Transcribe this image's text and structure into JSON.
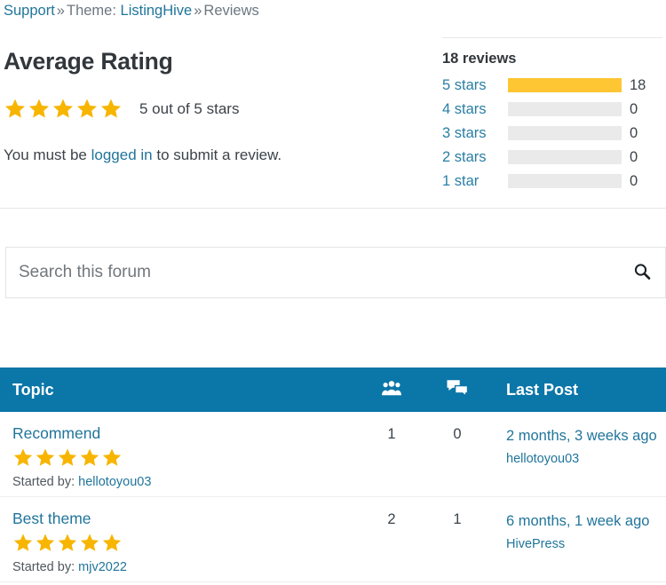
{
  "breadcrumb": {
    "support": "Support",
    "sep1": "»",
    "theme": "Theme: ListingHive",
    "sep2": "»",
    "current": "Reviews"
  },
  "rating": {
    "heading": "Average Rating",
    "stars_filled": 5,
    "summary": "5 out of 5 stars",
    "login_prefix": "You must be ",
    "login_link": "logged in",
    "login_suffix": " to submit a review."
  },
  "breakdown": {
    "title": "18 reviews",
    "total": 18,
    "rows": [
      {
        "label": "5 stars",
        "count": "18",
        "percent": 100
      },
      {
        "label": "4 stars",
        "count": "0",
        "percent": 0
      },
      {
        "label": "3 stars",
        "count": "0",
        "percent": 0
      },
      {
        "label": "2 stars",
        "count": "0",
        "percent": 0
      },
      {
        "label": "1 star",
        "count": "0",
        "percent": 0
      }
    ]
  },
  "search": {
    "placeholder": "Search this forum",
    "value": "",
    "icon": "search-icon"
  },
  "table": {
    "headers": {
      "topic": "Topic",
      "voices_icon": "users-icon",
      "replies_icon": "comments-icon",
      "last_post": "Last Post"
    },
    "rows": [
      {
        "title": "Recommend",
        "stars": 5,
        "started_by_label": "Started by: ",
        "started_by_user": "hellotoyou03",
        "voices": "1",
        "replies": "0",
        "last_time": "2 months, 3 weeks ago",
        "last_author": "hellotoyou03"
      },
      {
        "title": "Best theme",
        "stars": 5,
        "started_by_label": "Started by: ",
        "started_by_user": "mjv2022",
        "voices": "2",
        "replies": "1",
        "last_time": "6 months, 1 week ago",
        "last_author": "HivePress"
      }
    ]
  },
  "colors": {
    "link": "#21759b",
    "header_bar": "#0b76a8",
    "star": "#f7b500",
    "bar_fill": "#ffc633",
    "bar_track": "#eaeaea"
  }
}
